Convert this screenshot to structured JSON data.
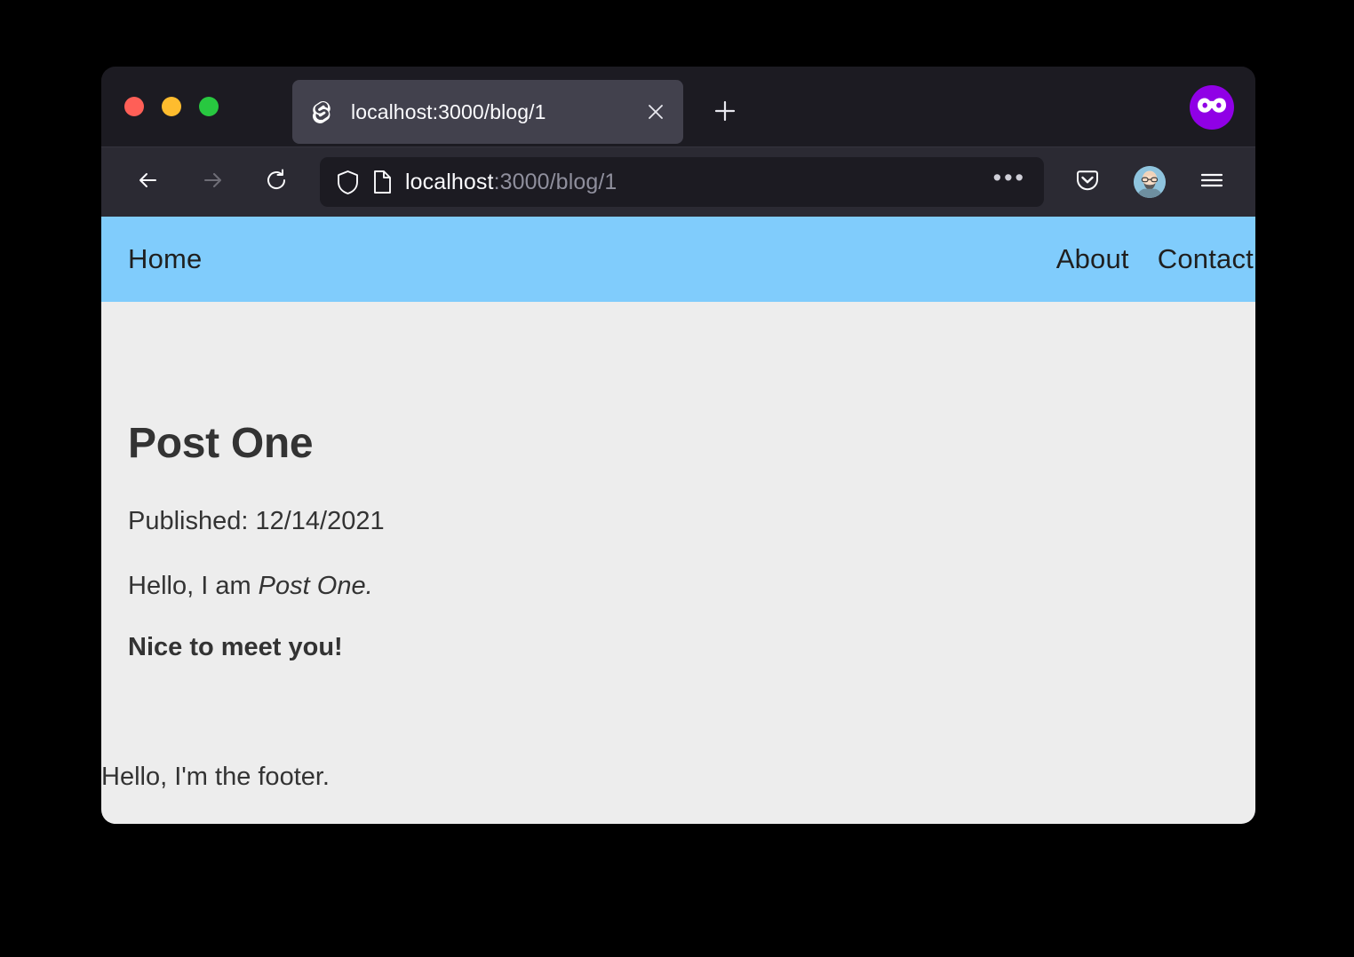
{
  "window": {
    "traffic_lights": [
      {
        "name": "close",
        "color": "#ff5f57"
      },
      {
        "name": "minimize",
        "color": "#febc2e"
      },
      {
        "name": "zoom",
        "color": "#28c840"
      }
    ]
  },
  "tabbar": {
    "active_tab": {
      "title": "localhost:3000/blog/1",
      "favicon": "svelte-logo-icon",
      "close_icon": "close-icon"
    },
    "new_tab_icon": "plus-icon",
    "private_badge_icon": "private-browsing-mask-icon",
    "private_badge_color": "#9000e6"
  },
  "toolbar": {
    "back_icon": "back-arrow-icon",
    "forward_icon": "forward-arrow-icon",
    "reload_icon": "reload-icon",
    "shield_icon": "shield-icon",
    "page_info_icon": "page-document-icon",
    "url_host": "localhost",
    "url_path": ":3000/blog/1",
    "page_actions_icon": "ellipsis-icon",
    "pocket_icon": "pocket-icon",
    "account_icon": "avatar-icon",
    "menu_icon": "hamburger-menu-icon"
  },
  "site": {
    "nav": {
      "background": "#80ccfc",
      "left_links": [
        {
          "label": "Home",
          "href": "/"
        }
      ],
      "right_links": [
        {
          "label": "About",
          "href": "/about"
        },
        {
          "label": "Contact",
          "href": "/contact"
        }
      ]
    },
    "post": {
      "title": "Post One",
      "published_label": "Published: 12/14/2021",
      "body_prefix": "Hello, I am ",
      "body_emphasis": "Post One.",
      "body_strong": "Nice to meet you!"
    },
    "footer": {
      "text": "Hello, I'm the footer."
    },
    "background": "#ededed"
  }
}
